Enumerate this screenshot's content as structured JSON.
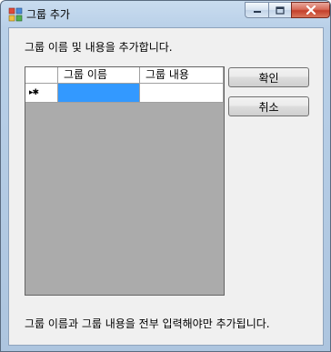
{
  "window": {
    "title": "그룹 추가",
    "buttons": [
      "minimize-icon",
      "maximize-icon",
      "close-icon"
    ]
  },
  "labels": {
    "instruction": "그룹 이름 및 내용을 추가합니다.",
    "footer": "그룹 이름과 그룹 내용을 전부 입력해야만 추가됩니다."
  },
  "grid": {
    "columns": [
      "그룹 이름",
      "그룹 내용"
    ],
    "rows": [
      {
        "indicator": "▸✱",
        "cells": [
          "",
          ""
        ]
      }
    ]
  },
  "actions": {
    "ok_label": "확인",
    "cancel_label": "취소"
  },
  "colors": {
    "selection": "#3399ff",
    "grid_background": "#ababab",
    "close_button": "#c43f2a"
  }
}
